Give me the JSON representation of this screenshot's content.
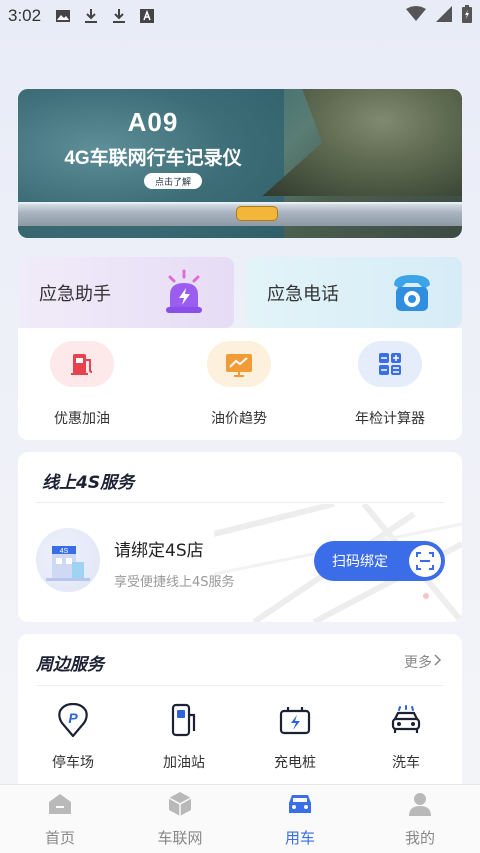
{
  "status_bar": {
    "time": "3:02"
  },
  "banner": {
    "title": "A09",
    "subtitle": "4G车联网行车记录仪",
    "cta": "点击了解"
  },
  "emergency": [
    {
      "label": "应急助手",
      "icon": "siren-icon"
    },
    {
      "label": "应急电话",
      "icon": "phone-icon"
    }
  ],
  "tools": [
    {
      "label": "优惠加油",
      "icon": "fuel-pump-icon",
      "bg": "#fde8ea"
    },
    {
      "label": "油价趋势",
      "icon": "trend-chart-icon",
      "bg": "#fdf0dc"
    },
    {
      "label": "年检计算器",
      "icon": "calculator-icon",
      "bg": "#e5edfb"
    }
  ],
  "service4s": {
    "title": "线上4S服务",
    "bind_title": "请绑定4S店",
    "bind_sub": "享受便捷线上4S服务",
    "bind_button": "扫码绑定",
    "store_sign": "4S"
  },
  "nearby": {
    "title": "周边服务",
    "more": "更多",
    "items": [
      {
        "label": "停车场",
        "icon": "parking-icon"
      },
      {
        "label": "加油站",
        "icon": "gas-station-icon"
      },
      {
        "label": "充电桩",
        "icon": "charging-pile-icon"
      },
      {
        "label": "洗车",
        "icon": "car-wash-icon"
      }
    ]
  },
  "bottom_nav": [
    {
      "label": "首页",
      "icon": "home-icon",
      "active": false
    },
    {
      "label": "车联网",
      "icon": "cube-icon",
      "active": false
    },
    {
      "label": "用车",
      "icon": "car-icon",
      "active": true
    },
    {
      "label": "我的",
      "icon": "user-icon",
      "active": false
    }
  ],
  "colors": {
    "accent": "#3a6ee8",
    "button": "#3c6de8"
  }
}
